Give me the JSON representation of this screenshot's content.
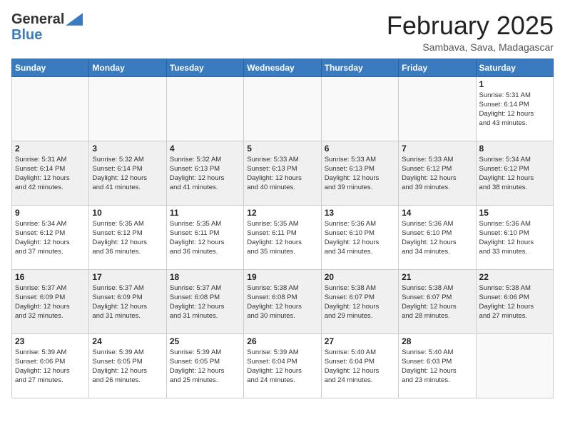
{
  "header": {
    "logo_general": "General",
    "logo_blue": "Blue",
    "title": "February 2025",
    "location": "Sambava, Sava, Madagascar"
  },
  "weekdays": [
    "Sunday",
    "Monday",
    "Tuesday",
    "Wednesday",
    "Thursday",
    "Friday",
    "Saturday"
  ],
  "weeks": [
    [
      {
        "day": "",
        "info": ""
      },
      {
        "day": "",
        "info": ""
      },
      {
        "day": "",
        "info": ""
      },
      {
        "day": "",
        "info": ""
      },
      {
        "day": "",
        "info": ""
      },
      {
        "day": "",
        "info": ""
      },
      {
        "day": "1",
        "info": "Sunrise: 5:31 AM\nSunset: 6:14 PM\nDaylight: 12 hours\nand 43 minutes."
      }
    ],
    [
      {
        "day": "2",
        "info": "Sunrise: 5:31 AM\nSunset: 6:14 PM\nDaylight: 12 hours\nand 42 minutes."
      },
      {
        "day": "3",
        "info": "Sunrise: 5:32 AM\nSunset: 6:14 PM\nDaylight: 12 hours\nand 41 minutes."
      },
      {
        "day": "4",
        "info": "Sunrise: 5:32 AM\nSunset: 6:13 PM\nDaylight: 12 hours\nand 41 minutes."
      },
      {
        "day": "5",
        "info": "Sunrise: 5:33 AM\nSunset: 6:13 PM\nDaylight: 12 hours\nand 40 minutes."
      },
      {
        "day": "6",
        "info": "Sunrise: 5:33 AM\nSunset: 6:13 PM\nDaylight: 12 hours\nand 39 minutes."
      },
      {
        "day": "7",
        "info": "Sunrise: 5:33 AM\nSunset: 6:12 PM\nDaylight: 12 hours\nand 39 minutes."
      },
      {
        "day": "8",
        "info": "Sunrise: 5:34 AM\nSunset: 6:12 PM\nDaylight: 12 hours\nand 38 minutes."
      }
    ],
    [
      {
        "day": "9",
        "info": "Sunrise: 5:34 AM\nSunset: 6:12 PM\nDaylight: 12 hours\nand 37 minutes."
      },
      {
        "day": "10",
        "info": "Sunrise: 5:35 AM\nSunset: 6:12 PM\nDaylight: 12 hours\nand 36 minutes."
      },
      {
        "day": "11",
        "info": "Sunrise: 5:35 AM\nSunset: 6:11 PM\nDaylight: 12 hours\nand 36 minutes."
      },
      {
        "day": "12",
        "info": "Sunrise: 5:35 AM\nSunset: 6:11 PM\nDaylight: 12 hours\nand 35 minutes."
      },
      {
        "day": "13",
        "info": "Sunrise: 5:36 AM\nSunset: 6:10 PM\nDaylight: 12 hours\nand 34 minutes."
      },
      {
        "day": "14",
        "info": "Sunrise: 5:36 AM\nSunset: 6:10 PM\nDaylight: 12 hours\nand 34 minutes."
      },
      {
        "day": "15",
        "info": "Sunrise: 5:36 AM\nSunset: 6:10 PM\nDaylight: 12 hours\nand 33 minutes."
      }
    ],
    [
      {
        "day": "16",
        "info": "Sunrise: 5:37 AM\nSunset: 6:09 PM\nDaylight: 12 hours\nand 32 minutes."
      },
      {
        "day": "17",
        "info": "Sunrise: 5:37 AM\nSunset: 6:09 PM\nDaylight: 12 hours\nand 31 minutes."
      },
      {
        "day": "18",
        "info": "Sunrise: 5:37 AM\nSunset: 6:08 PM\nDaylight: 12 hours\nand 31 minutes."
      },
      {
        "day": "19",
        "info": "Sunrise: 5:38 AM\nSunset: 6:08 PM\nDaylight: 12 hours\nand 30 minutes."
      },
      {
        "day": "20",
        "info": "Sunrise: 5:38 AM\nSunset: 6:07 PM\nDaylight: 12 hours\nand 29 minutes."
      },
      {
        "day": "21",
        "info": "Sunrise: 5:38 AM\nSunset: 6:07 PM\nDaylight: 12 hours\nand 28 minutes."
      },
      {
        "day": "22",
        "info": "Sunrise: 5:38 AM\nSunset: 6:06 PM\nDaylight: 12 hours\nand 27 minutes."
      }
    ],
    [
      {
        "day": "23",
        "info": "Sunrise: 5:39 AM\nSunset: 6:06 PM\nDaylight: 12 hours\nand 27 minutes."
      },
      {
        "day": "24",
        "info": "Sunrise: 5:39 AM\nSunset: 6:05 PM\nDaylight: 12 hours\nand 26 minutes."
      },
      {
        "day": "25",
        "info": "Sunrise: 5:39 AM\nSunset: 6:05 PM\nDaylight: 12 hours\nand 25 minutes."
      },
      {
        "day": "26",
        "info": "Sunrise: 5:39 AM\nSunset: 6:04 PM\nDaylight: 12 hours\nand 24 minutes."
      },
      {
        "day": "27",
        "info": "Sunrise: 5:40 AM\nSunset: 6:04 PM\nDaylight: 12 hours\nand 24 minutes."
      },
      {
        "day": "28",
        "info": "Sunrise: 5:40 AM\nSunset: 6:03 PM\nDaylight: 12 hours\nand 23 minutes."
      },
      {
        "day": "",
        "info": ""
      }
    ]
  ]
}
